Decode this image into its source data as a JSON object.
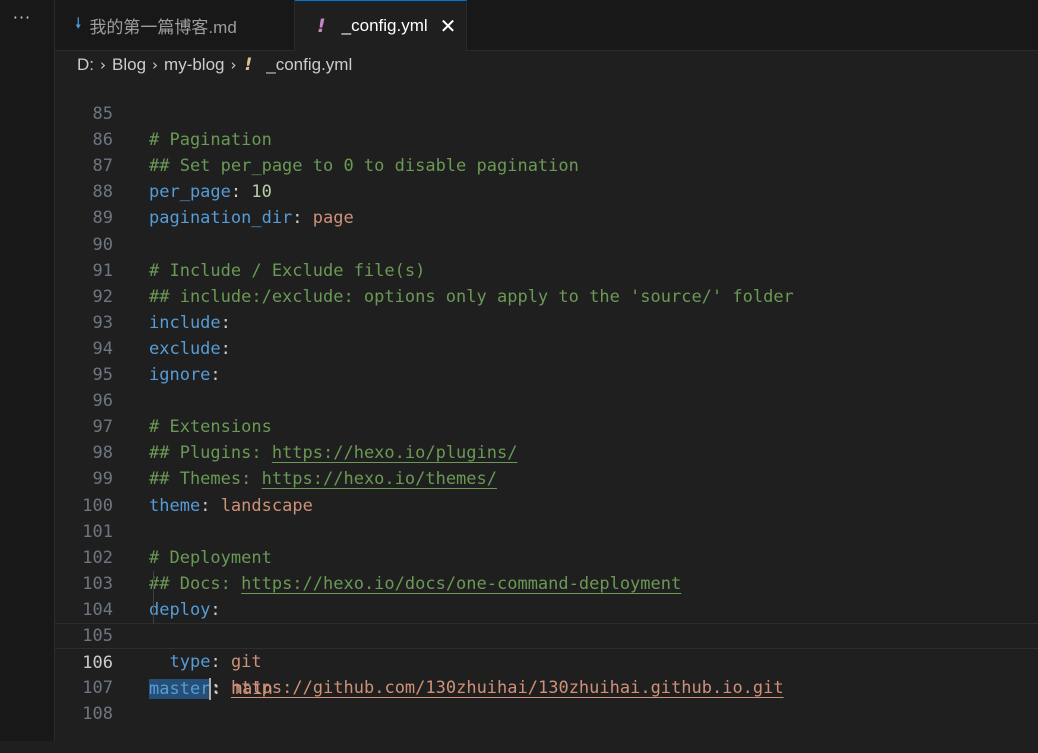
{
  "activity": {
    "more_label": "···"
  },
  "tabs": [
    {
      "label": "我的第一篇博客.md",
      "icon": "markdown-download-icon",
      "active": false
    },
    {
      "label": "_config.yml",
      "icon": "yaml-exclamation-icon",
      "active": true,
      "close": "✕"
    }
  ],
  "breadcrumb": {
    "drive": "D:",
    "sep": "›",
    "folder1": "Blog",
    "folder2": "my-blog",
    "yml_icon": "!",
    "file": "_config.yml"
  },
  "editor": {
    "lines": {
      "l85": {
        "num": "85",
        "comment": "# Pagination"
      },
      "l86": {
        "num": "86",
        "comment": "## Set per_page to 0 to disable pagination"
      },
      "l87": {
        "num": "87",
        "key": "per_page",
        "value": "10"
      },
      "l88": {
        "num": "88",
        "key": "pagination_dir",
        "value": "page"
      },
      "l89": {
        "num": "89"
      },
      "l90": {
        "num": "90",
        "comment": "# Include / Exclude file(s)"
      },
      "l91": {
        "num": "91",
        "comment": "## include:/exclude: options only apply to the 'source/' folder"
      },
      "l92": {
        "num": "92",
        "key": "include"
      },
      "l93": {
        "num": "93",
        "key": "exclude"
      },
      "l94": {
        "num": "94",
        "key": "ignore"
      },
      "l95": {
        "num": "95"
      },
      "l96": {
        "num": "96",
        "comment": "# Extensions"
      },
      "l97": {
        "num": "97",
        "comment_prefix": "## Plugins: ",
        "link": "https://hexo.io/plugins/"
      },
      "l98": {
        "num": "98",
        "comment_prefix": "## Themes: ",
        "link": "https://hexo.io/themes/"
      },
      "l99": {
        "num": "99",
        "key": "theme",
        "value": "landscape"
      },
      "l100": {
        "num": "100"
      },
      "l101": {
        "num": "101",
        "comment": "# Deployment"
      },
      "l102": {
        "num": "102",
        "comment_prefix": "## Docs: ",
        "link": "https://hexo.io/docs/one-command-deployment"
      },
      "l103": {
        "num": "103",
        "key": "deploy"
      },
      "l104": {
        "num": "104",
        "key": "type",
        "value": "git"
      },
      "l105": {
        "num": "105",
        "key": "repo",
        "value": "https://github.com/130zhuihai/130zhuihai.github.io.git"
      },
      "l106": {
        "num": "106",
        "key": "master",
        "value": "main"
      },
      "l107": {
        "num": "107"
      },
      "l108": {
        "num": "108"
      }
    },
    "colon": ":"
  }
}
